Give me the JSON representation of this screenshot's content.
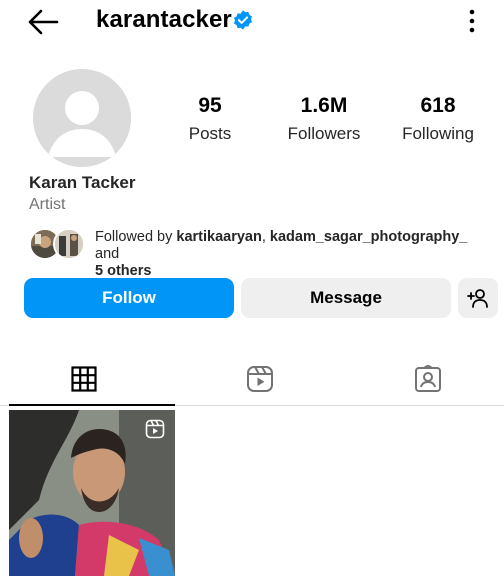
{
  "header": {
    "username": "karantacker",
    "back_icon": "arrow-left-icon",
    "verified_icon": "verified-badge-icon",
    "menu_icon": "more-vertical-icon"
  },
  "profile": {
    "display_name": "Karan Tacker",
    "category": "Artist",
    "avatar": "default-avatar-placeholder",
    "stats": [
      {
        "value": "95",
        "label": "Posts"
      },
      {
        "value": "1.6M",
        "label": "Followers"
      },
      {
        "value": "618",
        "label": "Following"
      }
    ]
  },
  "followed_by": {
    "prefix": "Followed by ",
    "user1": "kartikaaryan",
    "separator": ", ",
    "user2": "kadam_sagar_photography_",
    "connector": " and ",
    "others": "5 others"
  },
  "actions": {
    "follow_label": "Follow",
    "message_label": "Message",
    "add_user_icon": "add-user-icon"
  },
  "tabs": [
    {
      "name": "grid",
      "icon": "grid-icon",
      "active": true
    },
    {
      "name": "reels",
      "icon": "reels-icon",
      "active": false
    },
    {
      "name": "tagged",
      "icon": "tagged-icon",
      "active": false
    }
  ],
  "posts": [
    {
      "type": "reel",
      "badge_icon": "reel-icon"
    }
  ],
  "colors": {
    "accent": "#0095f6",
    "secondary_button": "#efefef",
    "verified": "#0095f6",
    "muted_text": "#737373"
  }
}
